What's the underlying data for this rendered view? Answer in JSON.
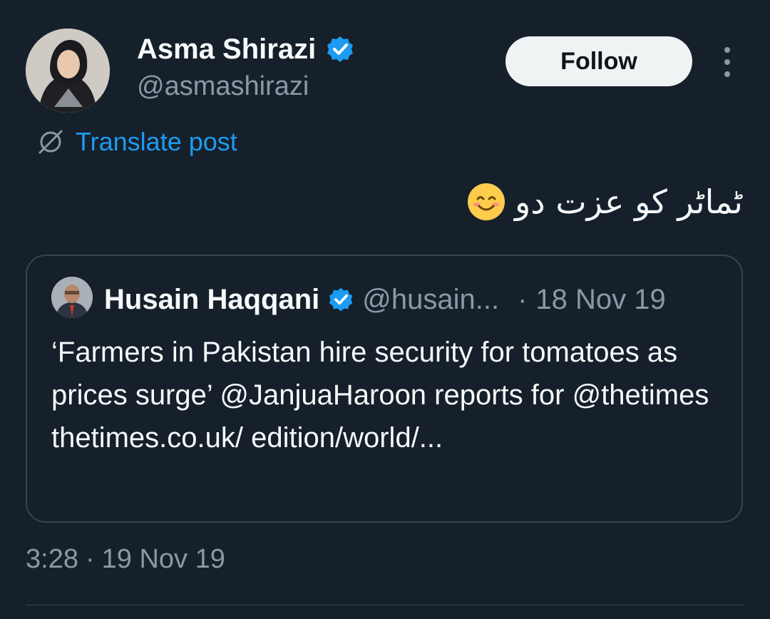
{
  "author": {
    "name": "Asma Shirazi",
    "handle": "@asmashirazi",
    "verified": true,
    "avatar_icon": "avatar-photo"
  },
  "actions": {
    "follow_label": "Follow",
    "more_icon": "more-vertical-icon"
  },
  "translate": {
    "label": "Translate post",
    "icon": "translate-globe-icon"
  },
  "post": {
    "text": "ٹماٹر کو عزت دو",
    "emoji": "smiling-face-emoji"
  },
  "quote": {
    "name": "Husain Haqqani",
    "handle": "@husain...",
    "separator": "·",
    "date": "18 Nov 19",
    "verified": true,
    "body": "‘Farmers in Pakistan hire security for tomatoes as prices surge’ @JanjuaHaroon reports for @thetimes thetimes.co.uk/ edition/world/..."
  },
  "meta": {
    "time": "3:28",
    "separator": "·",
    "date": "19 Nov 19"
  },
  "colors": {
    "background": "#15202b",
    "accent": "#1d9bf0",
    "secondary_text": "#8b98a5",
    "border": "#38444d"
  }
}
